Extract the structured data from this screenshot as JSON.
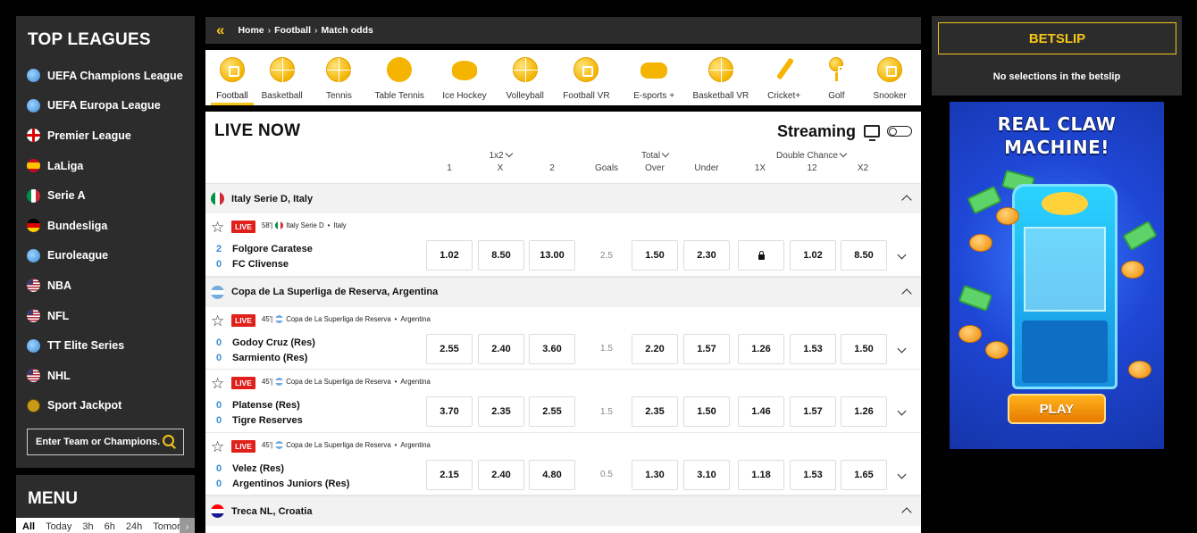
{
  "sidebar": {
    "title": "TOP LEAGUES",
    "leagues": [
      {
        "label": "UEFA Champions League",
        "flag": "globe"
      },
      {
        "label": "UEFA Europa League",
        "flag": "globe"
      },
      {
        "label": "Premier League",
        "flag": "en"
      },
      {
        "label": "LaLiga",
        "flag": "es"
      },
      {
        "label": "Serie A",
        "flag": "it"
      },
      {
        "label": "Bundesliga",
        "flag": "de"
      },
      {
        "label": "Euroleague",
        "flag": "globe"
      },
      {
        "label": "NBA",
        "flag": "us"
      },
      {
        "label": "NFL",
        "flag": "us"
      },
      {
        "label": "TT Elite Series",
        "flag": "globe"
      },
      {
        "label": "NHL",
        "flag": "us"
      },
      {
        "label": "Sport Jackpot",
        "flag": "jackpot"
      }
    ],
    "search_placeholder": "Enter Team or Champions..."
  },
  "menu": {
    "title": "MENU",
    "filters": [
      "All",
      "Today",
      "3h",
      "6h",
      "24h",
      "Tomorrow"
    ]
  },
  "breadcrumb": {
    "home": "Home",
    "sport": "Football",
    "page": "Match odds"
  },
  "sports": [
    {
      "label": "Football",
      "icon": "football-icon",
      "active": true
    },
    {
      "label": "Basketball",
      "icon": "basketball-icon"
    },
    {
      "label": "Tennis",
      "icon": "tennis-icon"
    },
    {
      "label": "Table Tennis",
      "icon": "table-tennis-icon"
    },
    {
      "label": "Ice Hockey",
      "icon": "ice-hockey-icon"
    },
    {
      "label": "Volleyball",
      "icon": "volleyball-icon"
    },
    {
      "label": "Football VR",
      "icon": "football-vr-icon"
    },
    {
      "label": "E-sports +",
      "icon": "gamepad-icon"
    },
    {
      "label": "Basketball VR",
      "icon": "basketball-vr-icon"
    },
    {
      "label": "Cricket+",
      "icon": "cricket-icon"
    },
    {
      "label": "Golf",
      "icon": "golf-icon"
    },
    {
      "label": "Snooker",
      "icon": "snooker-icon"
    }
  ],
  "live": {
    "title": "LIVE NOW",
    "streaming_label": "Streaming",
    "market_groups": {
      "m1x2": "1x2",
      "total": "Total",
      "double_chance": "Double Chance"
    },
    "columns": {
      "c1": "1",
      "cx": "X",
      "c2": "2",
      "goals": "Goals",
      "over": "Over",
      "under": "Under",
      "d1x": "1X",
      "d12": "12",
      "dx2": "X2"
    },
    "live_badge": "LIVE"
  },
  "leagues": [
    {
      "name": "Italy Serie D, Italy",
      "flag": "it",
      "matches": [
        {
          "minute": "58'",
          "comp": "Italy Serie D",
          "country": "Italy",
          "home": "Folgore Caratese",
          "away": "FC Clivense",
          "hs": "2",
          "as": "0",
          "odds": [
            "1.02",
            "8.50",
            "13.00"
          ],
          "goals": "2.5",
          "ou": [
            "1.50",
            "2.30"
          ],
          "dc": [
            "locked",
            "1.02",
            "8.50"
          ]
        }
      ]
    },
    {
      "name": "Copa de La Superliga de Reserva, Argentina",
      "flag": "ar",
      "matches": [
        {
          "minute": "45'",
          "comp": "Copa de La Superliga de Reserva",
          "country": "Argentina",
          "home": "Godoy Cruz (Res)",
          "away": "Sarmiento (Res)",
          "hs": "0",
          "as": "0",
          "odds": [
            "2.55",
            "2.40",
            "3.60"
          ],
          "goals": "1.5",
          "ou": [
            "2.20",
            "1.57"
          ],
          "dc": [
            "1.26",
            "1.53",
            "1.50"
          ]
        },
        {
          "minute": "45'",
          "comp": "Copa de La Superliga de Reserva",
          "country": "Argentina",
          "home": "Platense (Res)",
          "away": "Tigre Reserves",
          "hs": "0",
          "as": "0",
          "odds": [
            "3.70",
            "2.35",
            "2.55"
          ],
          "goals": "1.5",
          "ou": [
            "2.35",
            "1.50"
          ],
          "dc": [
            "1.46",
            "1.57",
            "1.26"
          ]
        },
        {
          "minute": "45'",
          "comp": "Copa de La Superliga de Reserva",
          "country": "Argentina",
          "home": "Velez (Res)",
          "away": "Argentinos Juniors (Res)",
          "hs": "0",
          "as": "0",
          "odds": [
            "2.15",
            "2.40",
            "4.80"
          ],
          "goals": "0.5",
          "ou": [
            "1.30",
            "3.10"
          ],
          "dc": [
            "1.18",
            "1.53",
            "1.65"
          ]
        }
      ]
    },
    {
      "name": "Treca NL, Croatia",
      "flag": "hr",
      "matches": []
    }
  ],
  "betslip": {
    "title": "BETSLIP",
    "empty_text": "No selections in the betslip"
  },
  "ad": {
    "title_line1": "REAL CLAW",
    "title_line2": "MACHINE!",
    "play_label": "PLAY"
  },
  "colors": {
    "accent": "#f5c518",
    "panel": "#2c2c2c",
    "live": "#e0201b",
    "score": "#3a8dd8"
  }
}
